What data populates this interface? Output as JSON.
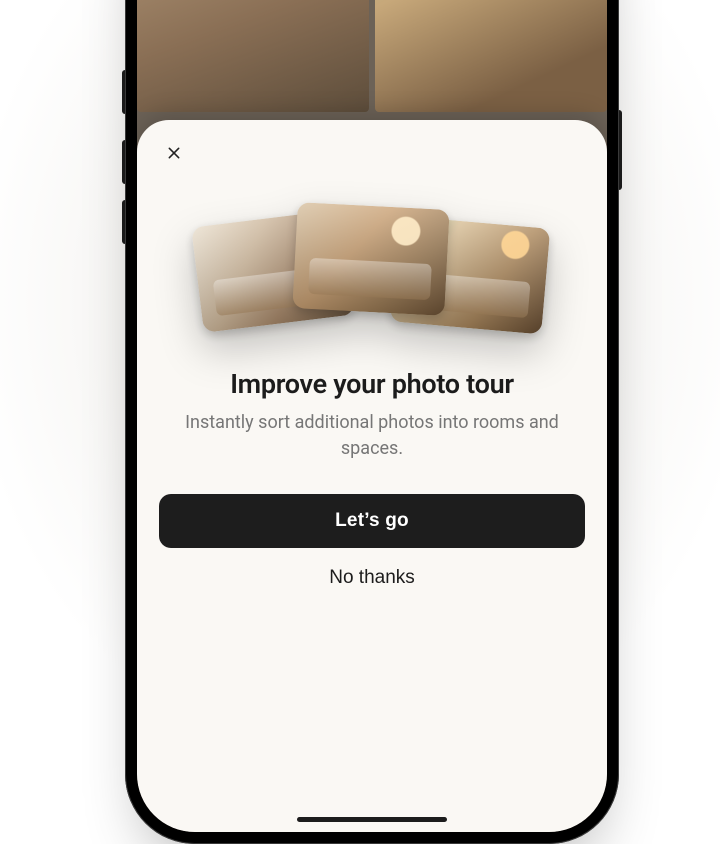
{
  "modal": {
    "title": "Improve your photo tour",
    "subtitle": "Instantly sort additional photos into rooms and spaces.",
    "primary_label": "Let’s go",
    "secondary_label": "No thanks",
    "close_icon": "close-icon"
  },
  "collage": {
    "photos": [
      "bedroom",
      "living-room",
      "dining-room"
    ]
  }
}
